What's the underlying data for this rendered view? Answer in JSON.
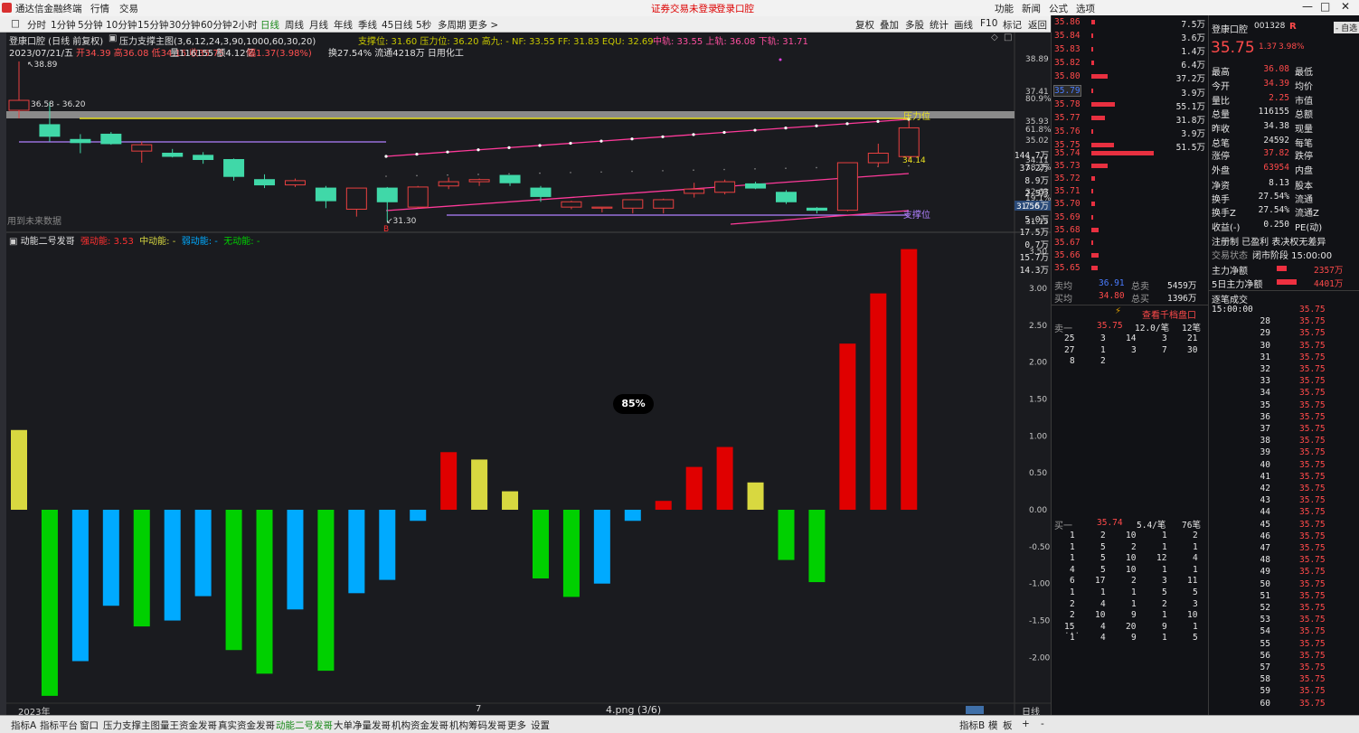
{
  "app": {
    "title": "通达信金融终端",
    "menu": [
      "行情",
      "交易"
    ],
    "center_notice": [
      "证券交易未登录",
      "登录口腔"
    ],
    "right_menu": [
      "功能",
      "新闻",
      "公式",
      "选项"
    ]
  },
  "toolbar": {
    "periods": [
      "分时",
      "1分钟",
      "5分钟",
      "10分钟",
      "15分钟",
      "30分钟",
      "60分钟",
      "2小时",
      "日线",
      "周线",
      "月线",
      "年线",
      "季线",
      "45日线",
      "5秒",
      "多周期",
      "更多 >"
    ],
    "right_buttons": [
      "复权",
      "叠加",
      "多股",
      "统计",
      "画线",
      "F10",
      "标记",
      "返回"
    ]
  },
  "main_chart": {
    "header1": "登康口腔 (日线 前复权)",
    "indicator_name": "压力支撑主图(3,6,12,24,3,90,1000,60,30,20)",
    "header1_tail": "支撑位: 31.60 压力位: 36.20 高九: - NF: 33.55 FF: 31.83 EQU: 32.69",
    "mid": "中轨: 33.55 上轨: 36.08 下轨: 31.71",
    "header2_date": "2023/07/21/五",
    "header2_ohlc": "开34.39 高36.08 低34.15 收35.75",
    "header2_vol": "量116155 额4.12亿",
    "header2_pct": "幅1.37(3.98%)",
    "header2_tail": "换27.54% 流通4218万 日用化工",
    "future_note": "用到未来数据",
    "label_high": "38.89",
    "label_low": "31.30",
    "label_range": "36.58 - 36.20",
    "label_pressure": "压力位",
    "label_support": "支撑位",
    "label_84": "34.14",
    "price_axis": [
      "38.89",
      "37.41",
      "35.93",
      "35.02",
      "34.11",
      "32.63",
      "31.56",
      "31.15"
    ],
    "pct_axis": [
      "80.9%",
      "61.8%",
      "38.2%",
      "19.1%"
    ],
    "current_price_tag": "31.56"
  },
  "candles": [
    {
      "o": 36.58,
      "h": 38.89,
      "l": 36.2,
      "c": 37.05
    },
    {
      "o": 35.9,
      "h": 36.95,
      "l": 35.1,
      "c": 35.35
    },
    {
      "o": 35.2,
      "h": 35.45,
      "l": 34.55,
      "c": 35.05
    },
    {
      "o": 35.45,
      "h": 35.55,
      "l": 34.95,
      "c": 35.0
    },
    {
      "o": 34.65,
      "h": 35.1,
      "l": 34.1,
      "c": 34.95
    },
    {
      "o": 34.55,
      "h": 34.75,
      "l": 34.35,
      "c": 34.4
    },
    {
      "o": 34.45,
      "h": 34.6,
      "l": 34.05,
      "c": 34.25
    },
    {
      "o": 34.25,
      "h": 34.3,
      "l": 33.25,
      "c": 33.45
    },
    {
      "o": 33.3,
      "h": 33.55,
      "l": 32.9,
      "c": 33.05
    },
    {
      "o": 33.05,
      "h": 33.35,
      "l": 32.95,
      "c": 33.25
    },
    {
      "o": 32.9,
      "h": 33.0,
      "l": 31.95,
      "c": 32.3
    },
    {
      "o": 31.9,
      "h": 32.9,
      "l": 31.55,
      "c": 32.9
    },
    {
      "o": 32.9,
      "h": 32.95,
      "l": 31.3,
      "c": 32.25
    },
    {
      "o": 32.0,
      "h": 33.0,
      "l": 31.95,
      "c": 32.95
    },
    {
      "o": 33.0,
      "h": 33.4,
      "l": 32.85,
      "c": 33.2
    },
    {
      "o": 33.2,
      "h": 33.35,
      "l": 33.0,
      "c": 33.3
    },
    {
      "o": 33.5,
      "h": 33.5,
      "l": 33.0,
      "c": 33.15
    },
    {
      "o": 32.9,
      "h": 33.0,
      "l": 32.25,
      "c": 32.5
    },
    {
      "o": 32.0,
      "h": 32.3,
      "l": 31.9,
      "c": 32.25
    },
    {
      "o": 31.95,
      "h": 32.0,
      "l": 31.75,
      "c": 32.0
    },
    {
      "o": 31.95,
      "h": 32.35,
      "l": 31.7,
      "c": 32.35
    },
    {
      "o": 31.95,
      "h": 32.4,
      "l": 31.7,
      "c": 32.35
    },
    {
      "o": 32.65,
      "h": 33.15,
      "l": 32.45,
      "c": 32.85
    },
    {
      "o": 32.7,
      "h": 33.3,
      "l": 32.6,
      "c": 33.2
    },
    {
      "o": 33.1,
      "h": 33.2,
      "l": 32.85,
      "c": 32.9
    },
    {
      "o": 32.7,
      "h": 32.8,
      "l": 32.15,
      "c": 32.25
    },
    {
      "o": 31.95,
      "h": 32.0,
      "l": 31.7,
      "c": 31.85
    },
    {
      "o": 31.85,
      "h": 34.1,
      "l": 31.8,
      "c": 34.1
    },
    {
      "o": 34.1,
      "h": 35.0,
      "l": 33.9,
      "c": 34.55
    },
    {
      "o": 34.39,
      "h": 36.08,
      "l": 34.15,
      "c": 35.75
    }
  ],
  "sub_chart": {
    "title": "动能二号发哥",
    "strong_label": "强动能:",
    "strong_val": "3.53",
    "mid_label": "中动能:",
    "mid_val": "-",
    "weak_label": "弱动能:",
    "weak_val": "-",
    "none_label": "无动能:",
    "none_val": "-",
    "axis": [
      "3.50",
      "3.00",
      "2.50",
      "2.00",
      "1.50",
      "1.00",
      "0.50",
      "0.00",
      "-0.50",
      "-1.00",
      "-1.50",
      "-2.00"
    ],
    "date_left": "2023年",
    "date_mid": "7"
  },
  "chart_data": {
    "type": "bar",
    "series": [
      {
        "name": "强动能",
        "values": [
          null,
          null,
          null,
          null,
          null,
          null,
          null,
          null,
          null,
          null,
          null,
          null,
          null,
          null,
          0.78,
          null,
          null,
          null,
          null,
          null,
          null,
          0.12,
          0.58,
          0.85,
          null,
          null,
          null,
          2.25,
          2.93,
          3.53
        ]
      },
      {
        "name": "中动能",
        "values": [
          1.08,
          null,
          null,
          null,
          null,
          null,
          null,
          null,
          null,
          null,
          null,
          null,
          null,
          null,
          null,
          0.68,
          0.25,
          null,
          null,
          null,
          null,
          null,
          null,
          null,
          0.37,
          null,
          null,
          null,
          null,
          null
        ]
      },
      {
        "name": "弱动能",
        "values": [
          null,
          null,
          -2.05,
          -1.3,
          null,
          -1.5,
          -1.17,
          null,
          null,
          -1.35,
          null,
          -1.13,
          -0.95,
          -0.15,
          null,
          null,
          null,
          null,
          null,
          -1.0,
          -0.15,
          null,
          null,
          null,
          null,
          null,
          null,
          null,
          null,
          null
        ]
      },
      {
        "name": "无动能",
        "values": [
          null,
          -2.52,
          null,
          null,
          -1.58,
          null,
          null,
          -1.9,
          -2.22,
          null,
          -2.18,
          null,
          null,
          null,
          null,
          null,
          null,
          -0.93,
          -1.18,
          null,
          null,
          null,
          null,
          null,
          null,
          -0.68,
          -0.98,
          null,
          null,
          null
        ]
      }
    ],
    "ylim": [
      -2.55,
      3.6
    ]
  },
  "quote": {
    "asks": [
      [
        "35.86",
        "7.5万"
      ],
      [
        "35.84",
        "3.6万"
      ],
      [
        "35.83",
        "1.4万"
      ],
      [
        "35.82",
        "6.4万"
      ],
      [
        "35.80",
        "37.2万"
      ],
      [
        "35.79",
        "3.9万"
      ],
      [
        "35.78",
        "55.1万"
      ],
      [
        "35.77",
        "31.8万"
      ],
      [
        "35.76",
        "3.9万"
      ],
      [
        "35.75",
        "51.5万"
      ]
    ],
    "bids": [
      [
        "35.74",
        "144.7万"
      ],
      [
        "35.73",
        "37.2万"
      ],
      [
        "35.72",
        "8.9万"
      ],
      [
        "35.71",
        "2.5万"
      ],
      [
        "35.70",
        "7.5万"
      ],
      [
        "35.69",
        "5.0万"
      ],
      [
        "35.68",
        "17.5万"
      ],
      [
        "35.67",
        "0.7万"
      ],
      [
        "35.66",
        "15.7万"
      ],
      [
        "35.65",
        "14.3万"
      ]
    ],
    "sell_avg_label": "卖均",
    "sell_avg": "36.91",
    "total_sell_label": "总卖",
    "total_sell": "5459万",
    "buy_avg_label": "买均",
    "buy_avg": "34.80",
    "total_buy_label": "总买",
    "total_buy": "1396万",
    "thousand_link": "查看千档盘口",
    "sell1_label": "卖一",
    "sell1_price": "35.75",
    "sell1_size": "12.0/笔",
    "sell1_count": "12笔",
    "sell1_rows": [
      [
        "25",
        "3",
        "14",
        "3",
        "21"
      ],
      [
        "27",
        "1",
        "3",
        "7",
        "30"
      ],
      [
        "8",
        "2",
        "",
        "",
        ""
      ]
    ],
    "buy1_label": "买一",
    "buy1_price": "35.74",
    "buy1_size": "5.4/笔",
    "buy1_count": "76笔",
    "buy1_rows": [
      [
        "1",
        "2",
        "10",
        "1",
        "2"
      ],
      [
        "1",
        "5",
        "2",
        "1",
        "1"
      ],
      [
        "1",
        "5",
        "10",
        "12",
        "4"
      ],
      [
        "4",
        "5",
        "10",
        "1",
        "1"
      ],
      [
        "6",
        "17",
        "2",
        "3",
        "11"
      ],
      [
        "1",
        "1",
        "1",
        "5",
        "5"
      ],
      [
        "2",
        "4",
        "1",
        "2",
        "3"
      ],
      [
        "2",
        "10",
        "9",
        "1",
        "10"
      ],
      [
        "15",
        "4",
        "20",
        "9",
        "1"
      ],
      [
        "1",
        "4",
        "9",
        "1",
        "5"
      ]
    ],
    "ellipsis": "..."
  },
  "info": {
    "stock_name": "登康口腔",
    "stock_code": "001328",
    "flag": "R",
    "watch_btn": "- 自选",
    "price": "35.75",
    "change": "1.37",
    "change_pct": "3.98%",
    "rows": [
      [
        "最高",
        "36.08",
        "最低"
      ],
      [
        "今开",
        "34.39",
        "均价"
      ],
      [
        "量比",
        "2.25",
        "市值"
      ],
      [
        "总量",
        "116155",
        "总额"
      ],
      [
        "昨收",
        "34.38",
        "现量"
      ],
      [
        "总笔",
        "24592",
        "每笔"
      ]
    ],
    "rows2": [
      [
        "涨停",
        "37.82",
        "跌停"
      ],
      [
        "外盘",
        "63954",
        "内盘"
      ]
    ],
    "rows3": [
      [
        "净资",
        "8.13",
        "股本"
      ],
      [
        "换手",
        "27.54%",
        "流通"
      ],
      [
        "换手Z",
        "27.54%",
        "流通Z"
      ],
      [
        "收益(-)",
        "0.250",
        "PE(动)"
      ]
    ],
    "reg": "注册制  已盈利  表决权无差异",
    "status_label": "交易状态",
    "status": "闭市阶段 15:00:00",
    "main_net_label": "主力净额",
    "main_net": "2357万",
    "main5_label": "5日主力净额",
    "main5": "4401万",
    "tick_title": "逐笔成交",
    "ticks": [
      [
        "15:00:00",
        "35.75"
      ],
      [
        "28",
        "35.75"
      ],
      [
        "29",
        "35.75"
      ],
      [
        "30",
        "35.75"
      ],
      [
        "31",
        "35.75"
      ],
      [
        "32",
        "35.75"
      ],
      [
        "33",
        "35.75"
      ],
      [
        "34",
        "35.75"
      ],
      [
        "35",
        "35.75"
      ],
      [
        "36",
        "35.75"
      ],
      [
        "37",
        "35.75"
      ],
      [
        "38",
        "35.75"
      ],
      [
        "39",
        "35.75"
      ],
      [
        "40",
        "35.75"
      ],
      [
        "41",
        "35.75"
      ],
      [
        "42",
        "35.75"
      ],
      [
        "43",
        "35.75"
      ],
      [
        "44",
        "35.75"
      ],
      [
        "45",
        "35.75"
      ],
      [
        "46",
        "35.75"
      ],
      [
        "47",
        "35.75"
      ],
      [
        "48",
        "35.75"
      ],
      [
        "49",
        "35.75"
      ],
      [
        "50",
        "35.75"
      ],
      [
        "51",
        "35.75"
      ],
      [
        "52",
        "35.75"
      ],
      [
        "53",
        "35.75"
      ],
      [
        "54",
        "35.75"
      ],
      [
        "55",
        "35.75"
      ],
      [
        "56",
        "35.75"
      ],
      [
        "57",
        "35.75"
      ],
      [
        "58",
        "35.75"
      ],
      [
        "59",
        "35.75"
      ],
      [
        "60",
        "35.75"
      ]
    ]
  },
  "bottom": {
    "tabs": [
      "指标A",
      "指标平台",
      "窗口",
      "压力支撑主图",
      "量王资金发哥",
      "真实资金发哥",
      "动能二号发哥",
      "大单净量发哥",
      "机构资金发哥",
      "机构筹码发哥",
      "更多",
      "设置"
    ],
    "file_label": "4.png (3/6)",
    "right": [
      "指标B",
      "模",
      "板",
      "+",
      "-"
    ],
    "period_right": "日线"
  },
  "overlay": {
    "zoom": "85%"
  },
  "colors": {
    "up": "#e84040",
    "down": "#40d8a8",
    "strong": "#e00000",
    "mid": "#d8d840",
    "weak": "#00aaff",
    "none": "#00d000"
  }
}
